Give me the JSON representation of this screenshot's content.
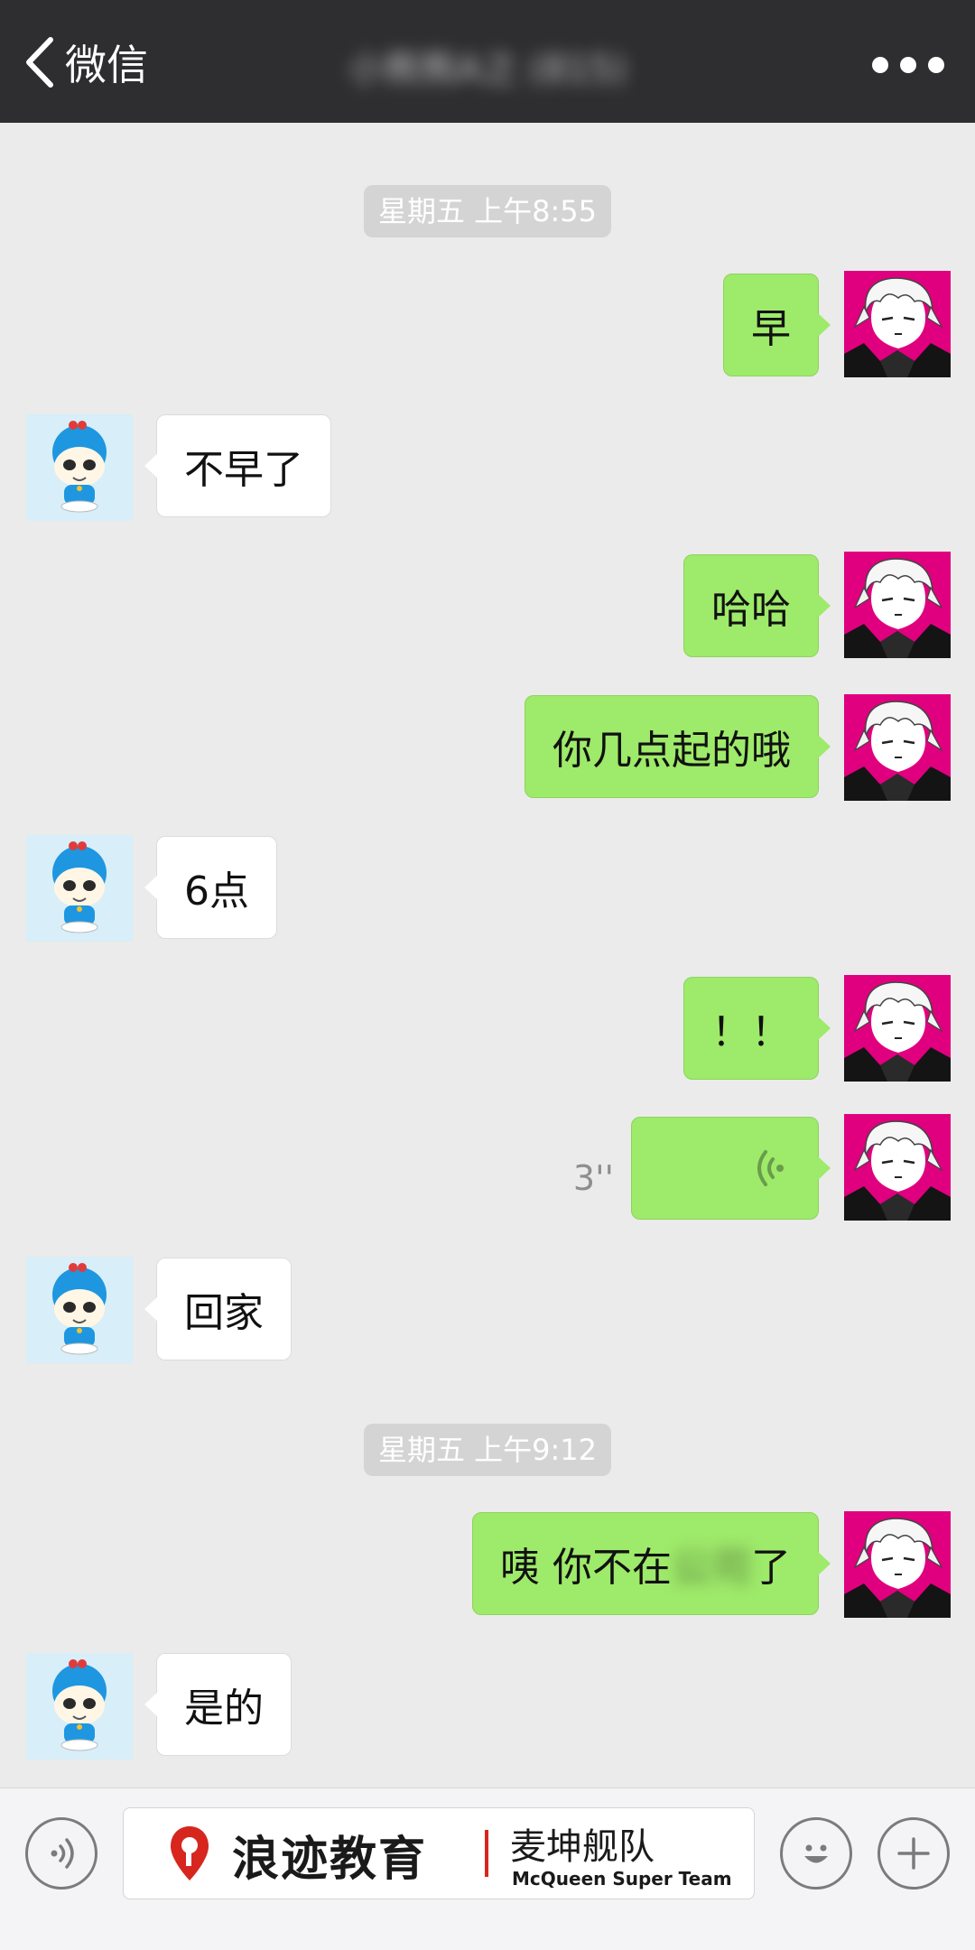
{
  "header": {
    "back_label": "微信",
    "title": "小熊熊A之 (815)"
  },
  "timestamps": [
    "星期五 上午8:55",
    "星期五 上午9:12"
  ],
  "messages": [
    {
      "from": "me",
      "text": "早"
    },
    {
      "from": "them",
      "text": "不早了"
    },
    {
      "from": "me",
      "text": "哈哈"
    },
    {
      "from": "me",
      "text": "你几点起的哦"
    },
    {
      "from": "them",
      "text": "6点"
    },
    {
      "from": "me",
      "text": "！！"
    },
    {
      "from": "me",
      "type": "voice",
      "duration": "3''"
    },
    {
      "from": "them",
      "text": "回家"
    },
    {
      "from": "me",
      "text_before": "咦 你不在",
      "text_blurred": "公司",
      "text_after": "了"
    },
    {
      "from": "them",
      "text": "是的"
    }
  ],
  "watermark": {
    "brand": "浪迹教育",
    "team": "麦坤舰队",
    "team_en": "McQueen Super Team"
  },
  "colors": {
    "header_bg": "#2e2e30",
    "chat_bg": "#ebebeb",
    "my_bubble": "#9eea6a",
    "their_bubble": "#ffffff",
    "timestamp_bg": "#d4d4d4",
    "my_avatar_bg": "#e0007f",
    "their_avatar_bg": "#d8eef8"
  }
}
